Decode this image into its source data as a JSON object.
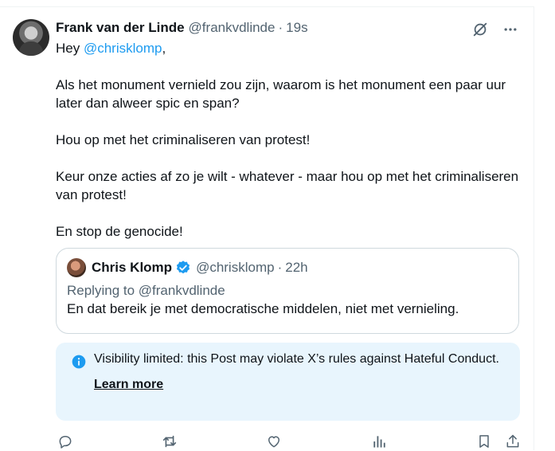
{
  "tweet": {
    "author_name": "Frank van der Linde",
    "author_handle": "@frankvdlinde",
    "separator": "·",
    "time": "19s",
    "greeting": "Hey ",
    "mention": "@chrisklomp",
    "greeting_end": ",",
    "paragraphs": [
      "Als het monument vernield zou zijn, waarom is het monument een paar uur later dan alweer spic en span?",
      "Hou op met het criminaliseren van protest!",
      "Keur onze acties af zo je wilt - whatever - maar hou op met het criminaliseren van protest!",
      "En stop de genocide!"
    ]
  },
  "quote": {
    "author_name": "Chris Klomp",
    "author_handle": "@chrisklomp",
    "separator": "·",
    "time": "22h",
    "replying_to": "Replying to @frankvdlinde",
    "text": "En dat bereik je met democratische middelen, niet met vernieling."
  },
  "notice": {
    "text": "Visibility limited: this Post may violate X’s rules against Hateful Conduct.",
    "link": "Learn more"
  },
  "icons": {
    "header": [
      "grok-icon",
      "more-icon"
    ],
    "actions": [
      "reply-icon",
      "repost-icon",
      "like-icon",
      "views-icon",
      "bookmark-icon",
      "share-icon"
    ]
  },
  "colors": {
    "accent": "#1d9bf0",
    "secondary_text": "#536471",
    "notice_bg": "#e8f5fd",
    "border": "#cfd9de"
  }
}
